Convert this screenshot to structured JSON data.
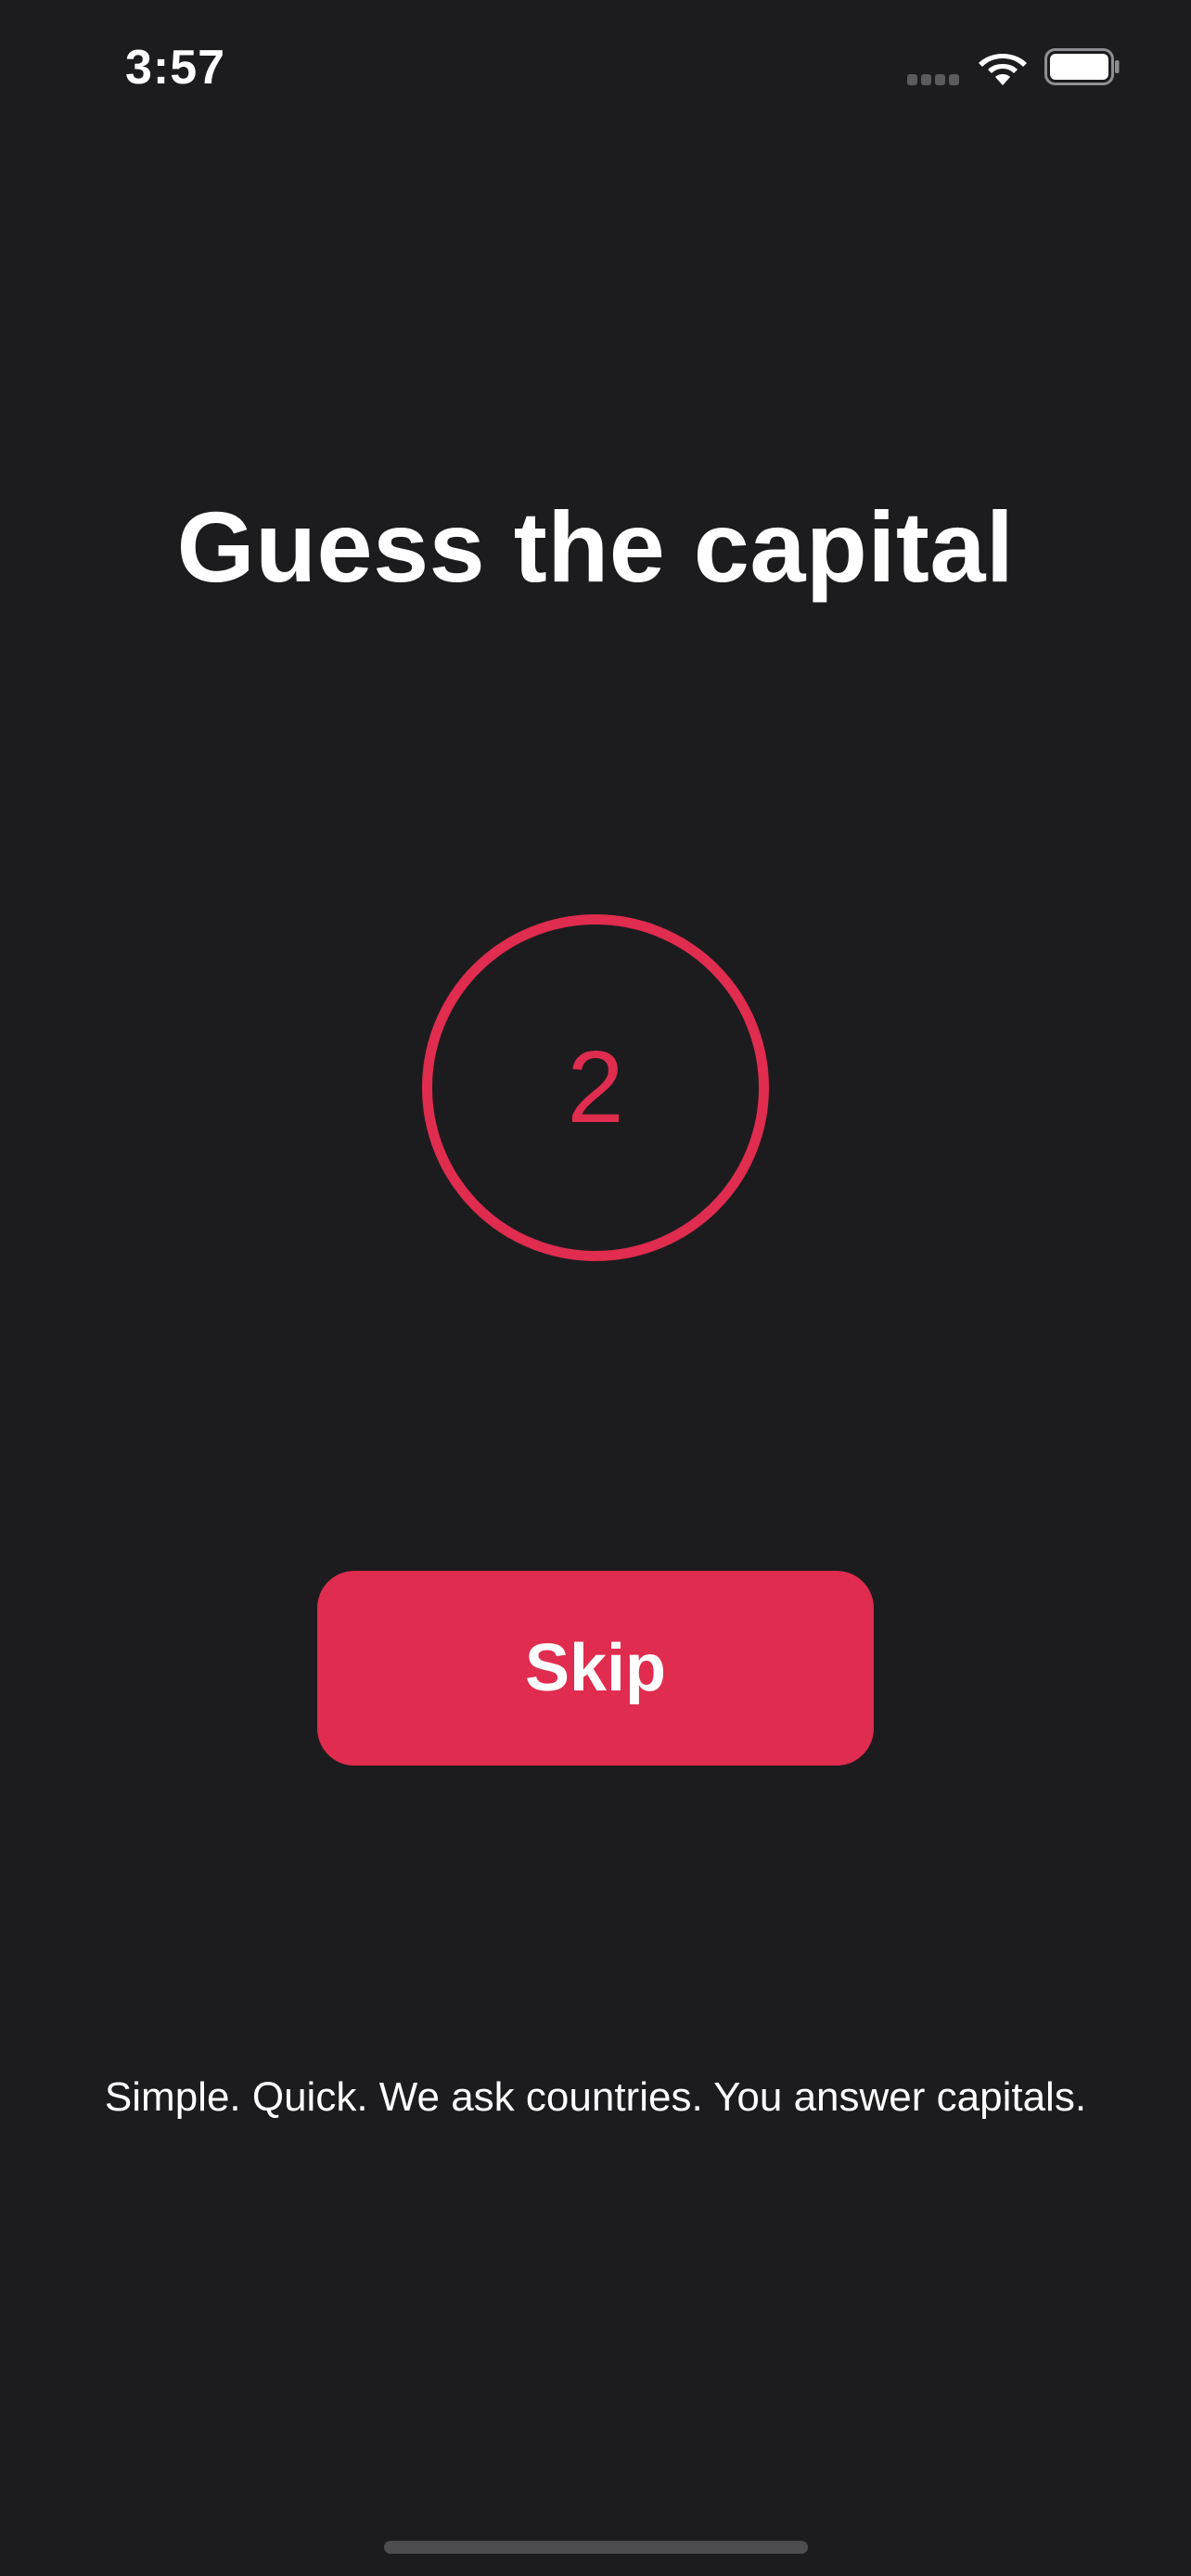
{
  "status_bar": {
    "time": "3:57",
    "icons": [
      "signal-icon",
      "wifi-icon",
      "battery-icon"
    ]
  },
  "main": {
    "title": "Guess the capital",
    "countdown": "2",
    "skip_label": "Skip",
    "tagline": "Simple. Quick. We ask countries. You answer capitals."
  },
  "colors": {
    "background": "#1c1c1e",
    "accent": "#df2c4f",
    "text": "#ffffff"
  }
}
